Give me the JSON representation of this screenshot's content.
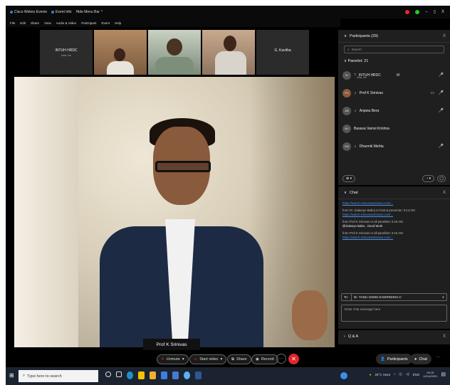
{
  "titlebar": {
    "items": [
      "Cisco Webex Events",
      "Event Info",
      "Hide Menu Bar"
    ]
  },
  "menubar": {
    "items": [
      "File",
      "Edit",
      "Share",
      "View",
      "Audio & Video",
      "Participant",
      "Event",
      "Help"
    ]
  },
  "window_controls": {
    "minimize": "–",
    "maximize": "▯",
    "close": "X"
  },
  "thumbnails": [
    {
      "name": "INTUH HRDC",
      "sub": "Host, me"
    },
    {
      "name": ""
    },
    {
      "name": ""
    },
    {
      "name": ""
    },
    {
      "name": "G. Kavitha"
    }
  ],
  "main_video": {
    "speaker_label": "Prof K Srinivas"
  },
  "controls": {
    "unmute": "Unmute",
    "start_video": "Start video",
    "share": "Share",
    "record": "Record",
    "more": "···",
    "end": "✕",
    "participants": "Participants",
    "chat": "Chat",
    "more_right": "···"
  },
  "participants_panel": {
    "title": "Participants (29)",
    "close": "X",
    "search_placeholder": "Search",
    "panelist_header": "Panelist: 21",
    "items": [
      {
        "initials": "IH",
        "name": "INTUH HRDC",
        "sub": "Host, me",
        "mute": "red"
      },
      {
        "initials": "PS",
        "name": "Prof K Srinivas",
        "mute": "green"
      },
      {
        "initials": "AB",
        "name": "Anjana Bera",
        "mute": "red"
      },
      {
        "initials": "BV",
        "name": "Basava Vamsi Krishna",
        "mute": "none"
      },
      {
        "initials": "DM",
        "name": "Dharmik Mehta",
        "mute": "red"
      }
    ]
  },
  "chat_panel": {
    "title": "Chat",
    "close": "X",
    "messages": [
      {
        "meta": "",
        "text": "https://watch.srinivaswebinars.com/...",
        "link": true
      },
      {
        "meta": "from Dr. (Saleeyn Babu) to host & presenter:   5:13 AM",
        "text": "https://watch.srinivaswebinars.com/...",
        "link": true
      },
      {
        "meta": "from Prof K Srinivas to all panelists:   5:15 AM",
        "text": "@Saleeyn Babu , Good Work",
        "link": false
      },
      {
        "meta": "from Prof K Srinivas to all panelists:   5:16 AM",
        "text": "https://watch.srinivaswebinars.com/...",
        "link": true
      }
    ],
    "to_label": "To:",
    "to_value": "Dr. YADU VAMSI SAIKRISHNA C",
    "input_placeholder": "Enter chat message here"
  },
  "qa_panel": {
    "title": "Q & A",
    "close": "X"
  },
  "taskbar": {
    "search_placeholder": "Type here to search",
    "weather": "25°C  Haze",
    "lang": "ENG",
    "time": "05:15",
    "date": "12/14/2021"
  }
}
